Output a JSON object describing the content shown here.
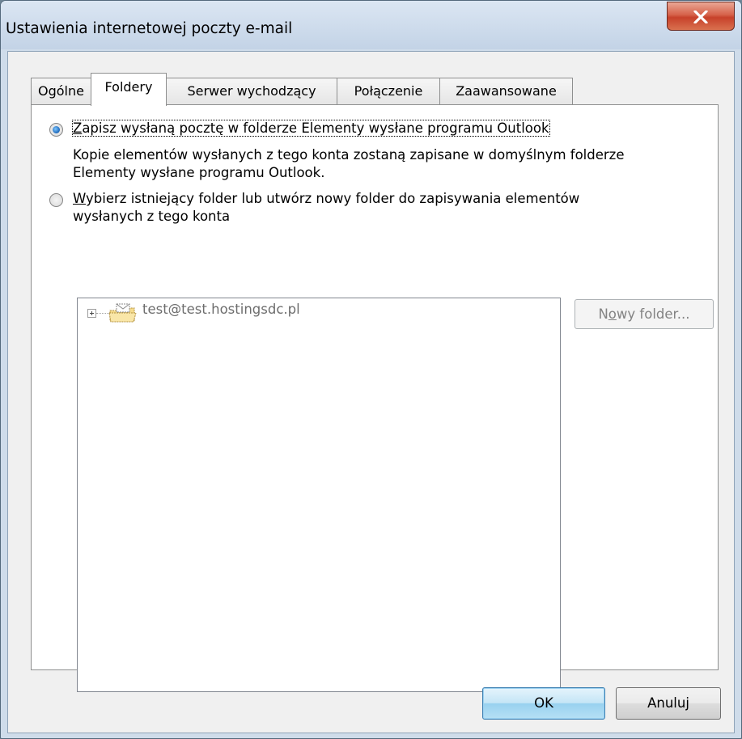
{
  "window": {
    "title": "Ustawienia internetowej poczty e-mail",
    "close_label": "X"
  },
  "tabs": [
    {
      "label": "Ogólne",
      "active": false
    },
    {
      "label": "Foldery",
      "active": true
    },
    {
      "label": "Serwer wychodzący",
      "active": false
    },
    {
      "label": "Połączenie",
      "active": false
    },
    {
      "label": "Zaawansowane",
      "active": false
    }
  ],
  "options": {
    "save_default": {
      "accel": "Z",
      "label_rest": "apisz wysłaną pocztę w folderze Elementy wysłane programu Outlook",
      "selected": true,
      "desc_line1": "Kopie elementów wysłanych z tego konta zostaną zapisane w domyślnym folderze",
      "desc_line2": "Elementy wysłane programu Outlook."
    },
    "choose_folder": {
      "accel": "W",
      "label_rest_line1": "ybierz istniejący folder lub utwórz nowy folder do zapisywania elementów",
      "label_line2": "wysłanych z tego konta",
      "selected": false
    }
  },
  "tree": {
    "items": [
      {
        "label": "test@test.hostingsdc.pl",
        "icon": "mailbox-folder-icon",
        "expanded": false
      }
    ]
  },
  "buttons": {
    "new_folder_prefix": "N",
    "new_folder_accel": "o",
    "new_folder_rest": "wy folder...",
    "ok": "OK",
    "cancel": "Anuluj"
  },
  "colors": {
    "title_bar": "#c9d8ea",
    "close_button": "#c7412a",
    "selection_accent": "#1a65b8"
  }
}
